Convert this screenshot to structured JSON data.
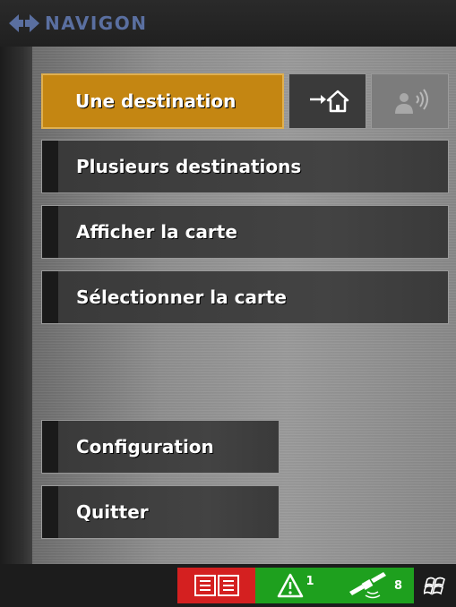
{
  "header": {
    "brand": "NAVIGON"
  },
  "menu": {
    "destination": "Une destination",
    "multi_destinations": "Plusieurs destinations",
    "show_map": "Afficher la carte",
    "select_map": "Sélectionner la carte",
    "configuration": "Configuration",
    "quit": "Quitter"
  },
  "quick_buttons": {
    "home_icon": "arrow-home-icon",
    "contact_icon": "person-speaker-icon"
  },
  "statusbar": {
    "tmc_icon": "tmc-book-icon",
    "traffic_count": "1",
    "gps_satellites": "8",
    "windows_icon": "windows-flag-icon"
  },
  "colors": {
    "active_button": "#c48612",
    "status_red": "#d42020",
    "status_green": "#1ea01e",
    "brand_blue": "#5a6fa0"
  }
}
